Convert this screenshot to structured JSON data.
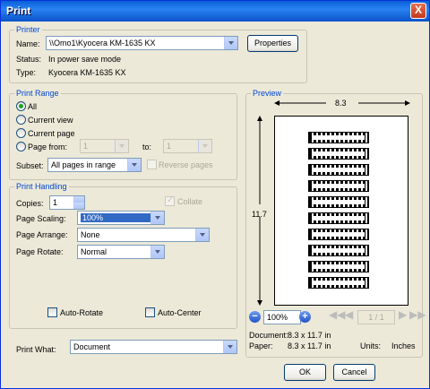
{
  "window": {
    "title": "Print",
    "close_label": "X"
  },
  "printer": {
    "legend": "Printer",
    "name_label": "Name:",
    "name_value": "\\\\Omo1\\Kyocera KM-1635 KX",
    "properties_label": "Properties",
    "status_label": "Status:",
    "status_value": "In power save mode",
    "type_label": "Type:",
    "type_value": "Kyocera KM-1635 KX"
  },
  "print_range": {
    "legend": "Print Range",
    "all_label": "All",
    "current_view_label": "Current view",
    "current_page_label": "Current page",
    "page_from_label": "Page from:",
    "from_value": "1",
    "to_label": "to:",
    "to_value": "1",
    "subset_label": "Subset:",
    "subset_value": "All pages in range",
    "reverse_label": "Reverse pages"
  },
  "print_handling": {
    "legend": "Print Handling",
    "copies_label": "Copies:",
    "copies_value": "1",
    "collate_label": "Collate",
    "scaling_label": "Page Scaling:",
    "scaling_value": "100%",
    "arrange_label": "Page Arrange:",
    "arrange_value": "None",
    "rotate_label": "Page Rotate:",
    "rotate_value": "Normal",
    "auto_rotate_label": "Auto-Rotate",
    "auto_center_label": "Auto-Center"
  },
  "print_what": {
    "label": "Print What:",
    "value": "Document"
  },
  "preview": {
    "legend": "Preview",
    "width_dim": "8.3",
    "height_dim": "11.7",
    "zoom_value": "100%",
    "page_indicator": "1 / 1",
    "document_label": "Document:",
    "document_value": "8.3 x 11.7 in",
    "paper_label": "Paper:",
    "paper_value": "8.3 x 11.7 in",
    "units_label": "Units:",
    "units_value": "Inches"
  },
  "buttons": {
    "ok": "OK",
    "cancel": "Cancel"
  }
}
